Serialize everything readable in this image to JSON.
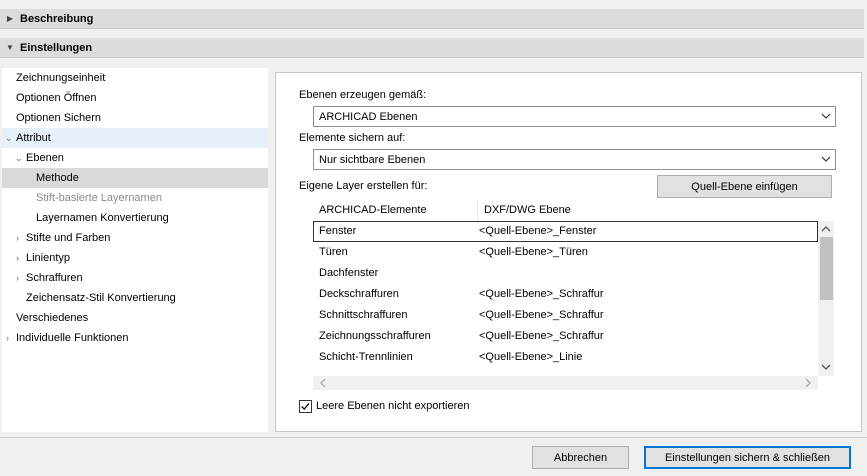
{
  "sections": {
    "beschreibung": "Beschreibung",
    "einstellungen": "Einstellungen"
  },
  "tree": [
    {
      "label": "Zeichnungseinheit"
    },
    {
      "label": "Optionen Öffnen"
    },
    {
      "label": "Optionen Sichern"
    },
    {
      "label": "Attribut"
    },
    {
      "label": "Ebenen"
    },
    {
      "label": "Methode"
    },
    {
      "label": "Stift-basierte Layernamen"
    },
    {
      "label": "Layernamen Konvertierung"
    },
    {
      "label": "Stifte und Farben"
    },
    {
      "label": "Linientyp"
    },
    {
      "label": "Schraffuren"
    },
    {
      "label": "Zeichensatz-Stil Konvertierung"
    },
    {
      "label": "Verschiedenes"
    },
    {
      "label": "Individuelle Funktionen"
    }
  ],
  "form": {
    "ebenen_label": "Ebenen erzeugen gemäß:",
    "ebenen_value": "ARCHICAD Ebenen",
    "sichern_label": "Elemente sichern auf:",
    "sichern_value": "Nur sichtbare Ebenen",
    "eigene_label": "Eigene Layer erstellen für:",
    "quell_button": "Quell-Ebene einfügen",
    "checkbox_label": "Leere Ebenen nicht exportieren",
    "checkbox_checked": true
  },
  "table": {
    "headers": [
      "ARCHICAD-Elemente",
      "DXF/DWG Ebene"
    ],
    "rows": [
      [
        "Fenster",
        "<Quell-Ebene>_Fenster"
      ],
      [
        "Türen",
        "<Quell-Ebene>_Türen"
      ],
      [
        "Dachfenster",
        ""
      ],
      [
        "Deckschraffuren",
        "<Quell-Ebene>_Schraffur"
      ],
      [
        "Schnittschraffuren",
        "<Quell-Ebene>_Schraffur"
      ],
      [
        "Zeichnungsschraffuren",
        "<Quell-Ebene>_Schraffur"
      ],
      [
        "Schicht-Trennlinien",
        "<Quell-Ebene>_Linie"
      ]
    ]
  },
  "buttons": {
    "cancel": "Abbrechen",
    "save_close": "Einstellungen sichern & schließen"
  }
}
